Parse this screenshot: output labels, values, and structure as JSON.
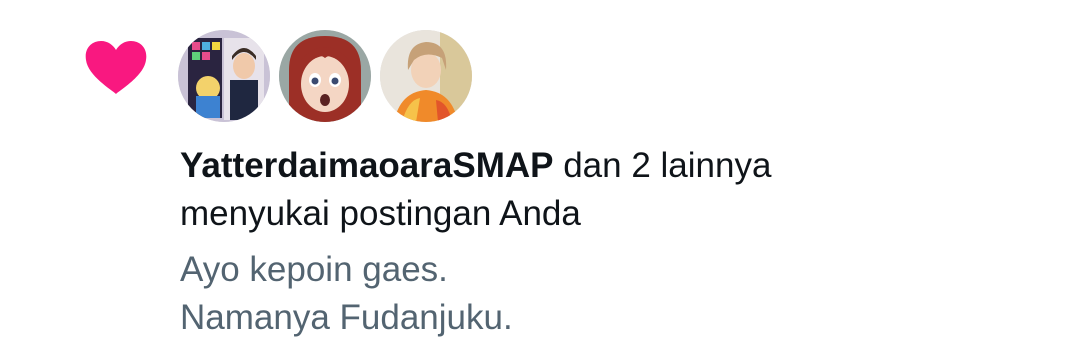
{
  "notification": {
    "icon": "heart-icon",
    "accent_color": "#f91880",
    "avatars": [
      {
        "name": "avatar-1"
      },
      {
        "name": "avatar-2"
      },
      {
        "name": "avatar-3"
      }
    ],
    "username": "YatterdaimaoaraSMAP",
    "action_line1_suffix": " dan 2 lainnya",
    "action_line2": "menyukai postingan Anda",
    "post_text_line1": "Ayo kepoin gaes.",
    "post_text_line2": "Namanya Fudanjuku."
  }
}
